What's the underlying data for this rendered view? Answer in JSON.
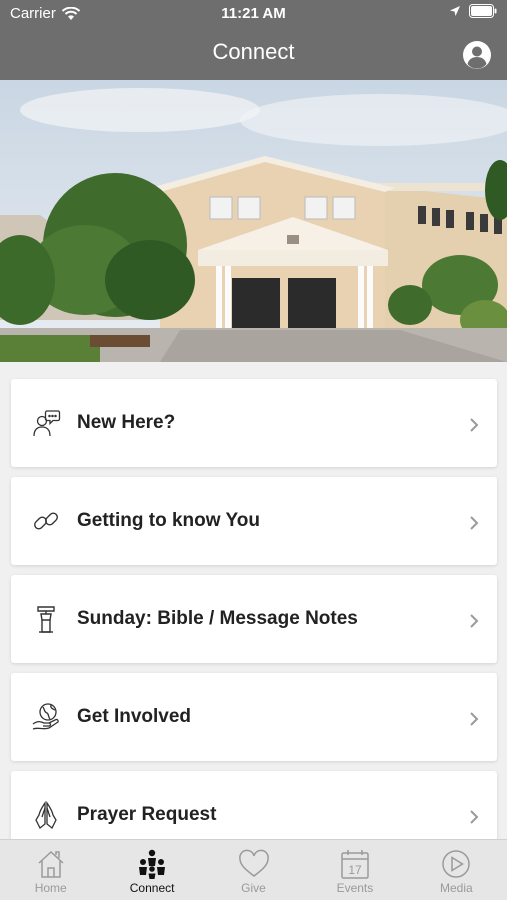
{
  "status_bar": {
    "carrier": "Carrier",
    "time": "11:21 AM"
  },
  "nav": {
    "title": "Connect"
  },
  "menu": [
    {
      "label": "New Here?",
      "icon": "speech-person-icon"
    },
    {
      "label": "Getting to know You",
      "icon": "link-icon"
    },
    {
      "label": "Sunday: Bible / Message Notes",
      "icon": "pulpit-icon"
    },
    {
      "label": "Get Involved",
      "icon": "globe-hand-icon"
    },
    {
      "label": "Prayer Request",
      "icon": "praying-hands-icon"
    }
  ],
  "tabs": [
    {
      "label": "Home",
      "icon": "home-icon",
      "active": false
    },
    {
      "label": "Connect",
      "icon": "people-icon",
      "active": true
    },
    {
      "label": "Give",
      "icon": "heart-icon",
      "active": false
    },
    {
      "label": "Events",
      "icon": "calendar-icon",
      "active": false,
      "badge": "17"
    },
    {
      "label": "Media",
      "icon": "play-icon",
      "active": false
    }
  ],
  "colors": {
    "header": "#6e6e6e",
    "tab_bar": "#e6e6e6",
    "tab_inactive": "#9a9a9a",
    "tab_active": "#111111"
  }
}
